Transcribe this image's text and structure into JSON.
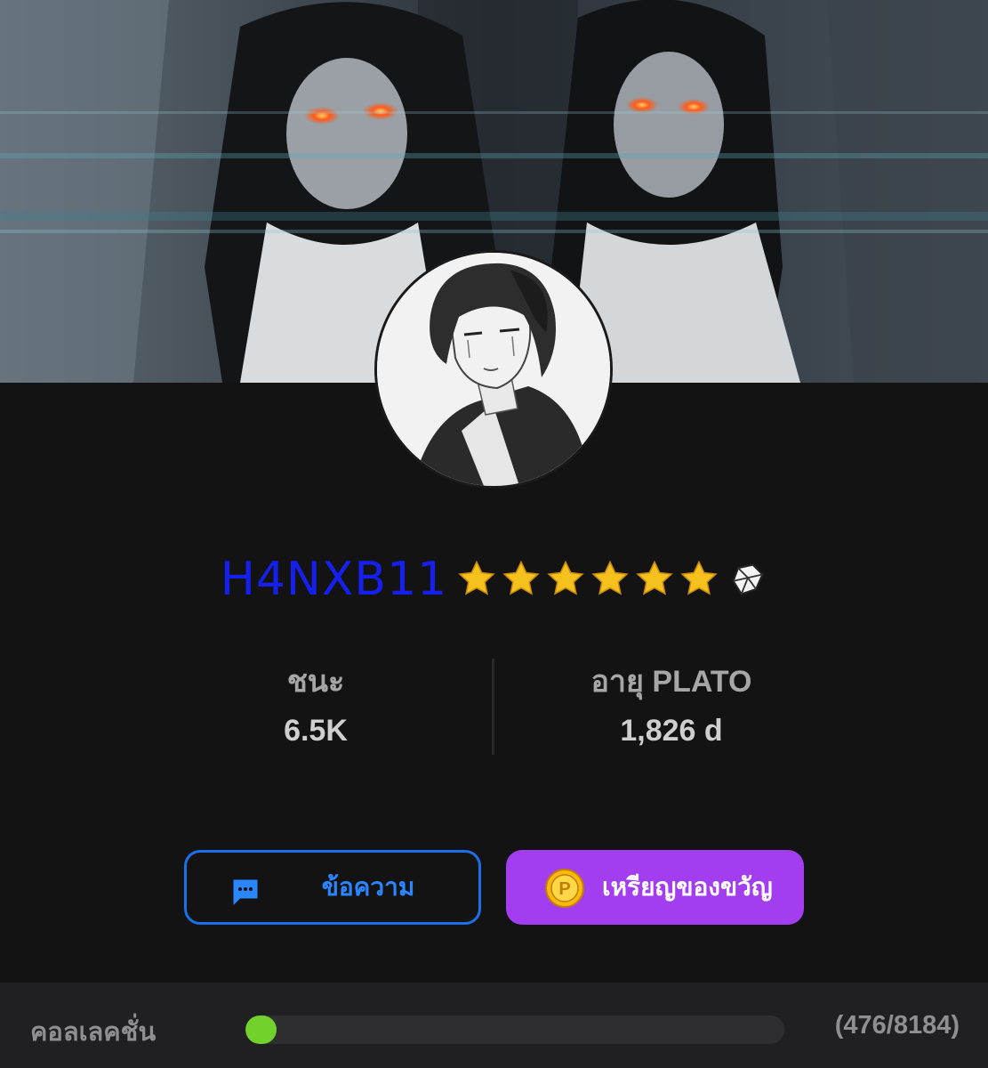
{
  "profile": {
    "username": "H4NXB11",
    "star_count": 6,
    "icons": {
      "rank": "star-icon",
      "badge": "crystal-badge-icon"
    },
    "colors": {
      "username": "#1620ee",
      "star": "#f5c21d"
    }
  },
  "stats": {
    "wins_label": "ชนะ",
    "wins_value": "6.5K",
    "age_label": "อายุ PLATO",
    "age_value": "1,826 d"
  },
  "actions": {
    "message_label": "ข้อความ",
    "message_icon": "chat-bubble-icon",
    "gift_label": "เหรียญของขวัญ",
    "gift_icon": "coin-icon",
    "colors": {
      "message_border": "#1b6fe8",
      "gift_bg": "#a23df0"
    }
  },
  "collection": {
    "label": "คอลเลคชั่น",
    "count_text": "(476/8184)",
    "progress": 0.058,
    "color": "#70d22b"
  }
}
